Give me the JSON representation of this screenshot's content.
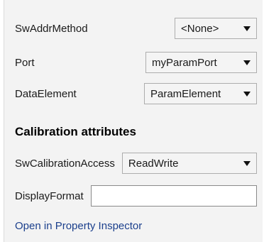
{
  "rows": {
    "sw_addr_method": {
      "label": "SwAddrMethod",
      "value": "<None>"
    },
    "port": {
      "label": "Port",
      "value": "myParamPort"
    },
    "data_element": {
      "label": "DataElement",
      "value": "ParamElement"
    }
  },
  "calibration": {
    "heading": "Calibration attributes",
    "sw_calibration_access": {
      "label": "SwCalibrationAccess",
      "value": "ReadWrite"
    },
    "display_format": {
      "label": "DisplayFormat",
      "value": ""
    }
  },
  "link": {
    "label": "Open in Property Inspector"
  },
  "icons": {
    "dropdown": "chevron-down-icon"
  }
}
